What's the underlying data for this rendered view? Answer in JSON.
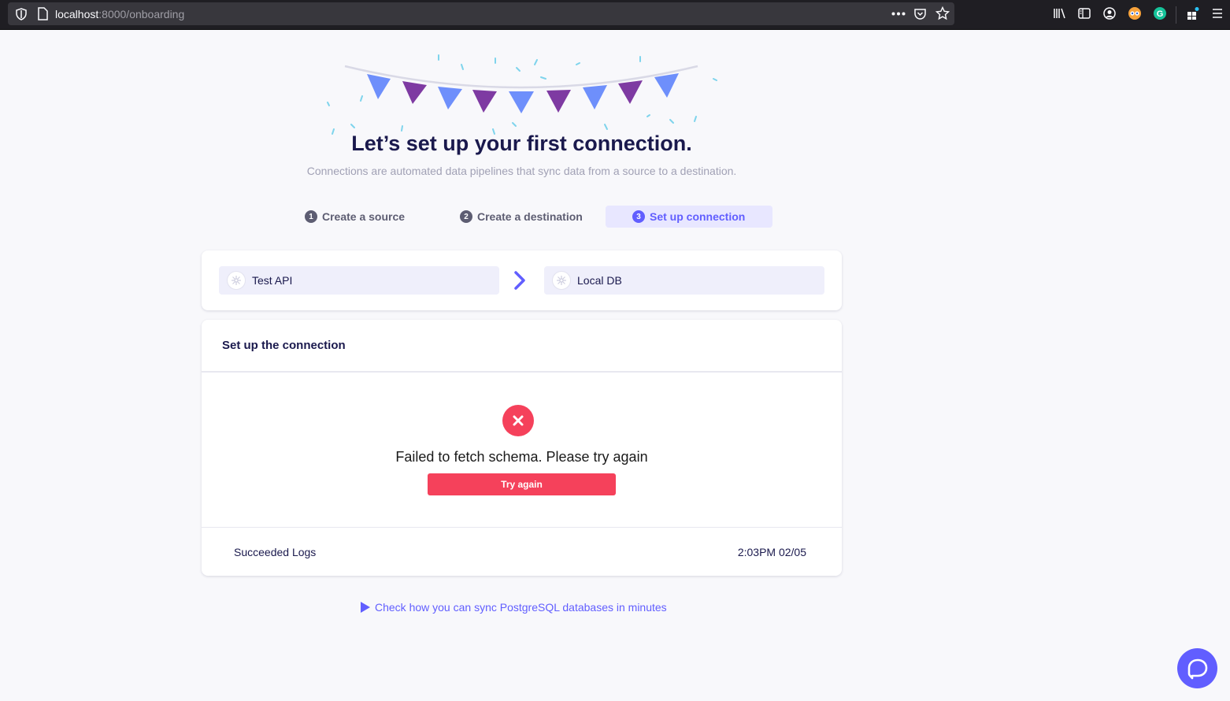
{
  "browser": {
    "url_host": "localhost",
    "url_path": ":8000/onboarding"
  },
  "page": {
    "title": "Let’s set up your first connection.",
    "subtitle": "Connections are automated data pipelines that sync data from a source to a destination."
  },
  "steps": [
    {
      "num": "1",
      "label": "Create a source",
      "active": false
    },
    {
      "num": "2",
      "label": "Create a destination",
      "active": false
    },
    {
      "num": "3",
      "label": "Set up connection",
      "active": true
    }
  ],
  "connection": {
    "source_name": "Test API",
    "destination_name": "Local DB"
  },
  "setup": {
    "header": "Set up the connection",
    "error_message": "Failed to fetch schema. Please try again",
    "retry_label": "Try again",
    "logs_label": "Succeeded Logs",
    "logs_time": "2:03PM 02/05"
  },
  "footer": {
    "video_link": "Check how you can sync PostgreSQL databases in minutes"
  },
  "colors": {
    "accent": "#615eff",
    "error": "#f5415b",
    "title": "#1a194d"
  }
}
